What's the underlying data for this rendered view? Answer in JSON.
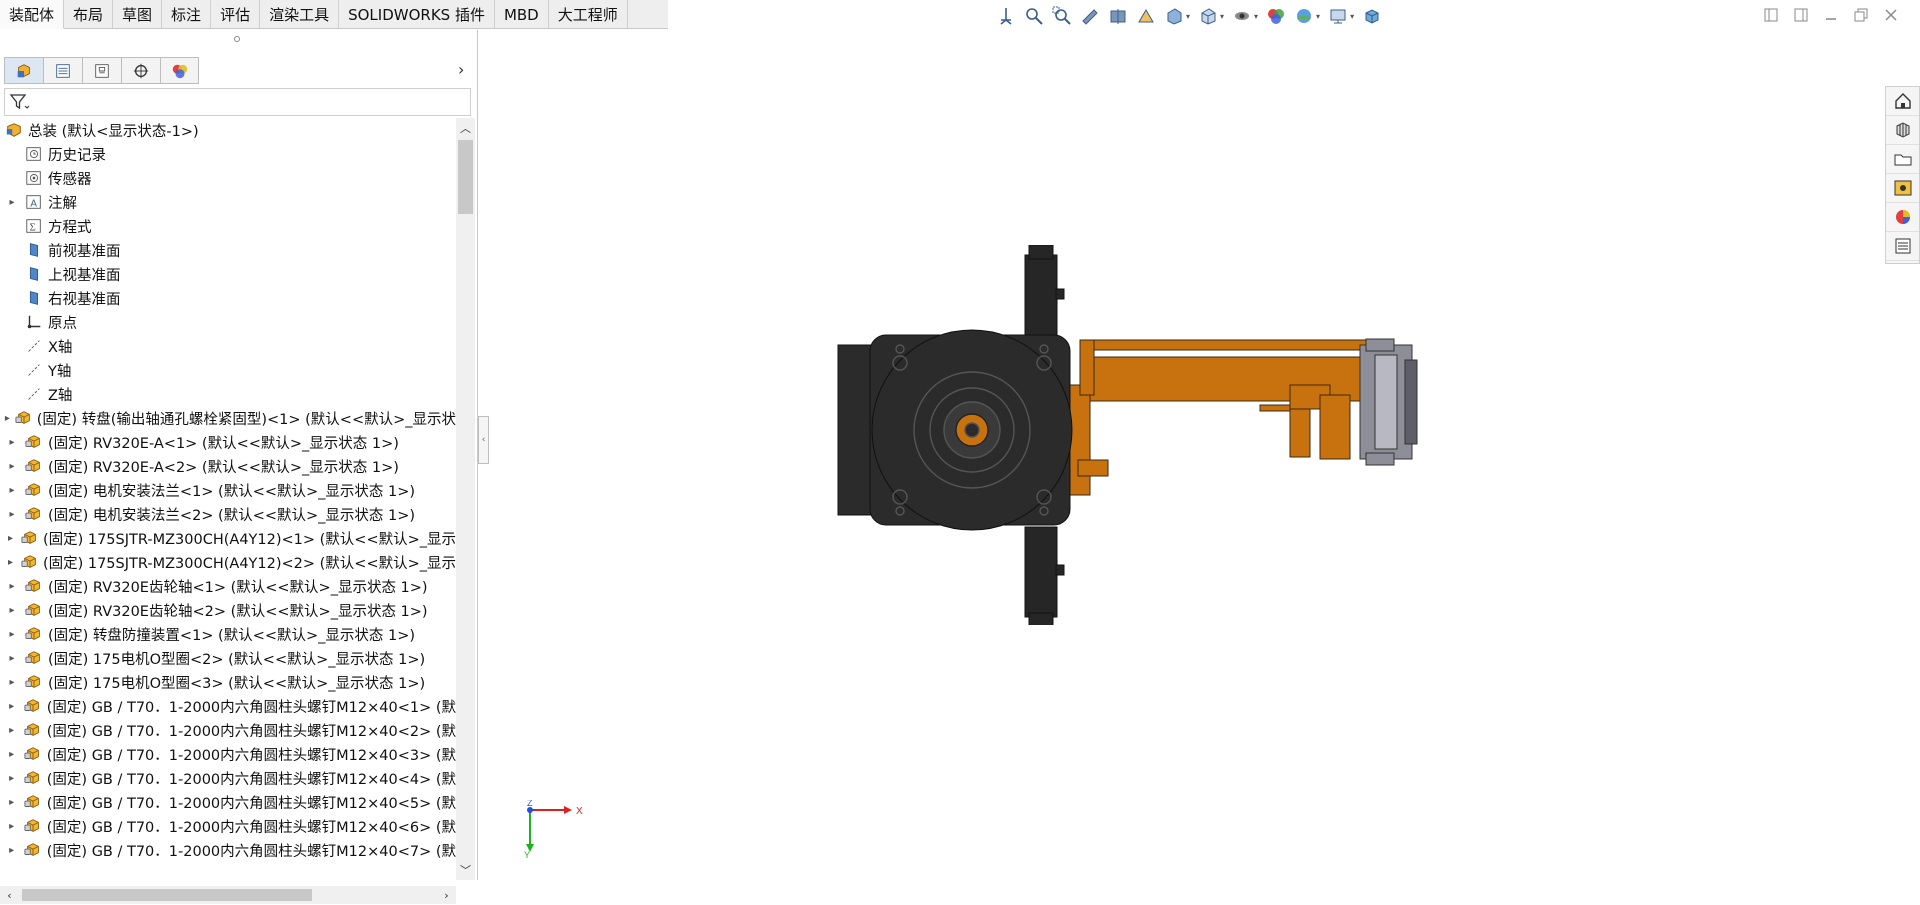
{
  "tabs": [
    "装配体",
    "布局",
    "草图",
    "标注",
    "评估",
    "渲染工具",
    "SOLIDWORKS 插件",
    "MBD",
    "大工程师"
  ],
  "active_tab": "装配体",
  "heads_up_icons": [
    "view-orientation-icon",
    "zoom-to-fit-icon",
    "zoom-area-icon",
    "previous-view-icon",
    "section-view-icon",
    "dynamic-annotation-icon",
    "view-orientation-box-icon",
    "display-style-icon",
    "hide-show-icon",
    "edit-appearance-icon",
    "apply-scene-icon",
    "view-settings-icon",
    "3d-view-icon"
  ],
  "panel_tabs": [
    "featuremanager-icon",
    "propertymanager-icon",
    "configurationmanager-icon",
    "dimxpert-icon",
    "displaymanager-icon"
  ],
  "tree": [
    {
      "label": "总装  (默认<显示状态-1>)",
      "icon": "assembly-icon",
      "expander": "",
      "indent": 0
    },
    {
      "label": "历史记录",
      "icon": "history-icon",
      "expander": "",
      "indent": 1
    },
    {
      "label": "传感器",
      "icon": "sensor-icon",
      "expander": "",
      "indent": 1
    },
    {
      "label": "注解",
      "icon": "annotation-icon",
      "expander": "▸",
      "indent": 1
    },
    {
      "label": "方程式",
      "icon": "equation-icon",
      "expander": "",
      "indent": 1
    },
    {
      "label": "前视基准面",
      "icon": "plane-icon",
      "expander": "",
      "indent": 1
    },
    {
      "label": "上视基准面",
      "icon": "plane-icon",
      "expander": "",
      "indent": 1
    },
    {
      "label": "右视基准面",
      "icon": "plane-icon",
      "expander": "",
      "indent": 1
    },
    {
      "label": "原点",
      "icon": "origin-icon",
      "expander": "",
      "indent": 1
    },
    {
      "label": "X轴",
      "icon": "axis-icon",
      "expander": "",
      "indent": 1
    },
    {
      "label": "Y轴",
      "icon": "axis-icon",
      "expander": "",
      "indent": 1
    },
    {
      "label": "Z轴",
      "icon": "axis-icon",
      "expander": "",
      "indent": 1
    },
    {
      "label": "(固定) 转盘(输出轴通孔螺栓紧固型)<1> (默认<<默认>_显示状",
      "icon": "part-icon",
      "expander": "▸",
      "indent": 1
    },
    {
      "label": "(固定) RV320E-A<1> (默认<<默认>_显示状态 1>)",
      "icon": "part-icon",
      "expander": "▸",
      "indent": 1
    },
    {
      "label": "(固定) RV320E-A<2> (默认<<默认>_显示状态 1>)",
      "icon": "part-icon",
      "expander": "▸",
      "indent": 1
    },
    {
      "label": "(固定) 电机安装法兰<1> (默认<<默认>_显示状态 1>)",
      "icon": "part-icon",
      "expander": "▸",
      "indent": 1
    },
    {
      "label": "(固定) 电机安装法兰<2> (默认<<默认>_显示状态 1>)",
      "icon": "part-icon",
      "expander": "▸",
      "indent": 1
    },
    {
      "label": "(固定) 175SJTR-MZ300CH(A4Y12)<1> (默认<<默认>_显示",
      "icon": "part-icon",
      "expander": "▸",
      "indent": 1
    },
    {
      "label": "(固定) 175SJTR-MZ300CH(A4Y12)<2> (默认<<默认>_显示",
      "icon": "part-icon",
      "expander": "▸",
      "indent": 1
    },
    {
      "label": "(固定) RV320E齿轮轴<1> (默认<<默认>_显示状态 1>)",
      "icon": "part-icon",
      "expander": "▸",
      "indent": 1
    },
    {
      "label": "(固定) RV320E齿轮轴<2> (默认<<默认>_显示状态 1>)",
      "icon": "part-icon",
      "expander": "▸",
      "indent": 1
    },
    {
      "label": "(固定) 转盘防撞装置<1> (默认<<默认>_显示状态 1>)",
      "icon": "part-icon",
      "expander": "▸",
      "indent": 1
    },
    {
      "label": "(固定) 175电机O型圈<2> (默认<<默认>_显示状态 1>)",
      "icon": "part-icon",
      "expander": "▸",
      "indent": 1
    },
    {
      "label": "(固定) 175电机O型圈<3> (默认<<默认>_显示状态 1>)",
      "icon": "part-icon",
      "expander": "▸",
      "indent": 1
    },
    {
      "label": "(固定) GB / T70．1-2000内六角圆柱头螺钉M12×40<1> (默",
      "icon": "part-icon",
      "expander": "▸",
      "indent": 1
    },
    {
      "label": "(固定) GB / T70．1-2000内六角圆柱头螺钉M12×40<2> (默",
      "icon": "part-icon",
      "expander": "▸",
      "indent": 1
    },
    {
      "label": "(固定) GB / T70．1-2000内六角圆柱头螺钉M12×40<3> (默",
      "icon": "part-icon",
      "expander": "▸",
      "indent": 1
    },
    {
      "label": "(固定) GB / T70．1-2000内六角圆柱头螺钉M12×40<4> (默",
      "icon": "part-icon",
      "expander": "▸",
      "indent": 1
    },
    {
      "label": "(固定) GB / T70．1-2000内六角圆柱头螺钉M12×40<5> (默",
      "icon": "part-icon",
      "expander": "▸",
      "indent": 1
    },
    {
      "label": "(固定) GB / T70．1-2000内六角圆柱头螺钉M12×40<6> (默",
      "icon": "part-icon",
      "expander": "▸",
      "indent": 1
    },
    {
      "label": "(固定) GB / T70．1-2000内六角圆柱头螺钉M12×40<7> (默",
      "icon": "part-icon",
      "expander": "▸",
      "indent": 1
    }
  ],
  "task_pane_icons": [
    "home-icon",
    "design-library-icon",
    "file-explorer-icon",
    "view-palette-icon",
    "appearances-icon",
    "custom-properties-icon"
  ],
  "triad": {
    "x": "X",
    "y": "Y",
    "z": "Z"
  },
  "colors": {
    "model_dark": "#2b2b2b",
    "model_orange": "#c8720f",
    "model_gray": "#7b7b85",
    "triad_x": "#e02020",
    "triad_y": "#20b020",
    "triad_z": "#2050e0"
  }
}
